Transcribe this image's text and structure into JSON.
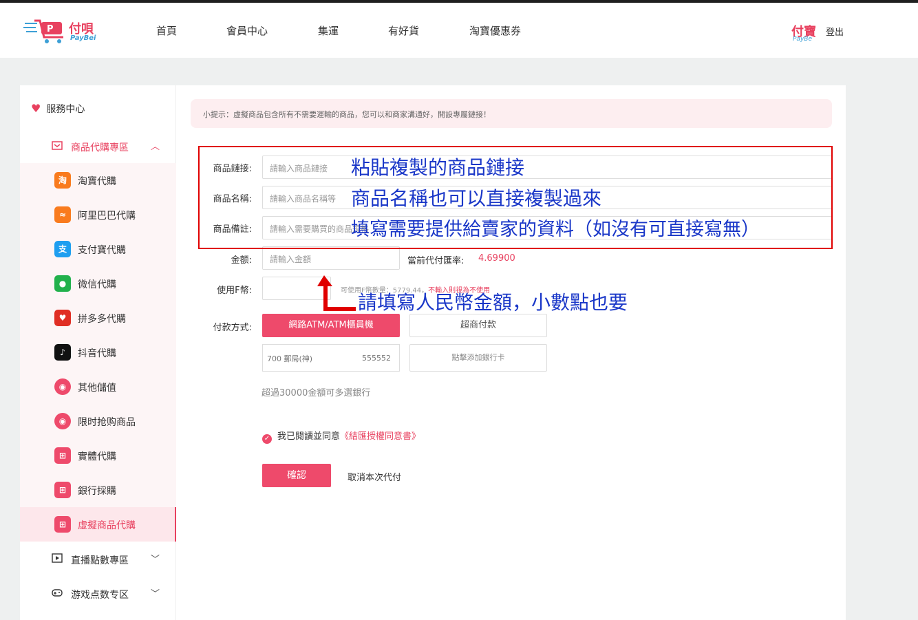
{
  "header": {
    "brand": "付唄",
    "brand_sub": "PayBei",
    "nav": [
      "首頁",
      "會員中心",
      "集運",
      "有好貨",
      "淘寶優惠券"
    ],
    "user_logo": "付寶",
    "user_logo_sub": "PayBe",
    "logout": "登出"
  },
  "sidebar": {
    "service_center": "服務中心",
    "group_purchase": "商品代購專區",
    "items": [
      {
        "label": "淘寶代購",
        "icon": "taobao-icon",
        "glyph": "淘",
        "color": "#f97b1e"
      },
      {
        "label": "阿里巴巴代購",
        "icon": "alibaba-icon",
        "glyph": "≈",
        "color": "#f97b1e"
      },
      {
        "label": "支付寶代購",
        "icon": "alipay-icon",
        "glyph": "支",
        "color": "#1e9ef0"
      },
      {
        "label": "微信代購",
        "icon": "wechat-icon",
        "glyph": "●",
        "color": "#22b14c"
      },
      {
        "label": "拼多多代購",
        "icon": "pinduoduo-icon",
        "glyph": "♥",
        "color": "#e02e24"
      },
      {
        "label": "抖音代購",
        "icon": "douyin-icon",
        "glyph": "♪",
        "color": "#111111"
      },
      {
        "label": "其他儲值",
        "icon": "piggy-bank-icon",
        "glyph": "◉",
        "color": "#ee4a6b"
      },
      {
        "label": "限时抢购商品",
        "icon": "flash-sale-icon",
        "glyph": "◉",
        "color": "#ee4a6b"
      },
      {
        "label": "實體代購",
        "icon": "cart-icon",
        "glyph": "⊞",
        "color": "#ee4a6b"
      },
      {
        "label": "銀行採購",
        "icon": "cart-icon",
        "glyph": "⊞",
        "color": "#ee4a6b"
      },
      {
        "label": "虛擬商品代購",
        "icon": "cart-icon",
        "glyph": "⊞",
        "color": "#ee4a6b"
      }
    ],
    "group_live": "直播點數專區",
    "group_game": "游戏点数专区"
  },
  "tip": "小提示：虛擬商品包含所有不需要運輸的商品，您可以和商家溝通好，開設專屬鏈接！",
  "form": {
    "link_label": "商品鏈接:",
    "link_placeholder": "請輸入商品鏈接",
    "name_label": "商品名稱:",
    "name_placeholder": "請輸入商品名稱等",
    "note_label": "商品備註:",
    "note_placeholder": "請輸入需要購買的商品規格",
    "amount_label": "金额:",
    "amount_placeholder": "請輸入金額",
    "rate_label": "當前代付匯率:",
    "rate_value": "4.69900",
    "fcoin_label": "使用F幣:",
    "fcoin_available": "可使用F幣數量：5779.44，",
    "fcoin_warning": "不輸入則視為不使用",
    "pay_label": "付款方式:",
    "pay_atm": "網路ATM/ATM櫃員機",
    "pay_store": "超商付款",
    "bank_name": "700 郵局(神)",
    "bank_code": "555552",
    "add_bank": "點擊添加銀行卡",
    "multi_bank_note": "超過30000金額可多選銀行",
    "agree_text": "我已閱讀並同意",
    "agree_link": "《結匯授權同意書》",
    "confirm": "確認",
    "cancel": "取消本次代付"
  },
  "annotations": {
    "line1": "粘貼複製的商品鏈接",
    "line2": "商品名稱也可以直接複製過來",
    "line3": "填寫需要提供給賣家的資料（如沒有可直接寫無）",
    "line4": "請填寫人民幣金額，小數點也要"
  },
  "colors": {
    "accent": "#ee4a6b",
    "annotation": "#1a37c8",
    "frame": "#e00000"
  }
}
